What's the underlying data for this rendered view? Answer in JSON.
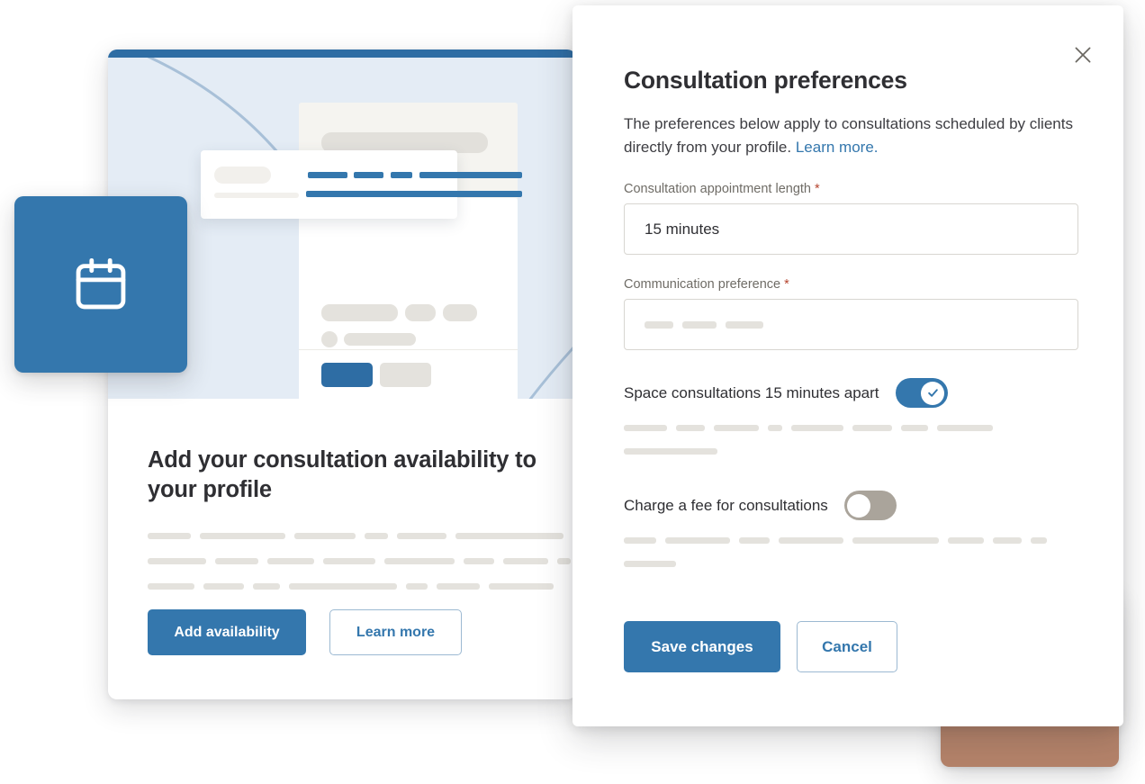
{
  "colors": {
    "brand_blue": "#3477ad",
    "brand_blue_dark": "#2e6da4",
    "illustration_bg": "#e4ecf5",
    "terracotta": "#b5836a",
    "skeleton": "#e4e2dd",
    "required_asterisk": "#b5442e",
    "toggle_off": "#aaa49b"
  },
  "promo_card": {
    "title": "Add your consultation availability to your profile",
    "primary_button": "Add availability",
    "secondary_button": "Learn more",
    "body_skeleton_rows": [
      [
        48,
        95,
        68,
        26,
        55,
        120
      ],
      [
        65,
        48,
        52,
        58,
        78,
        34,
        50,
        62,
        30
      ],
      [
        52,
        45,
        30,
        120,
        24,
        48,
        72
      ]
    ]
  },
  "illustration": {
    "calendar_tile_icon": "calendar-icon",
    "document_tile_icon": "document-icon"
  },
  "modal": {
    "close_icon": "close-icon",
    "title": "Consultation preferences",
    "description_prefix": "The preferences below apply to consultations scheduled by clients directly from your profile. ",
    "description_link": "Learn more.",
    "fields": [
      {
        "label": "Consultation appointment length",
        "required": true,
        "value": "15 minutes",
        "placeholder": ""
      },
      {
        "label": "Communication preference",
        "required": true,
        "value": "",
        "placeholder": ""
      }
    ],
    "toggles": [
      {
        "label": "Space consultations 15 minutes apart",
        "state": "on",
        "icon": "check-icon"
      },
      {
        "label": "Charge a fee for consultations",
        "state": "off",
        "icon": ""
      }
    ],
    "save_button": "Save changes",
    "cancel_button": "Cancel"
  }
}
